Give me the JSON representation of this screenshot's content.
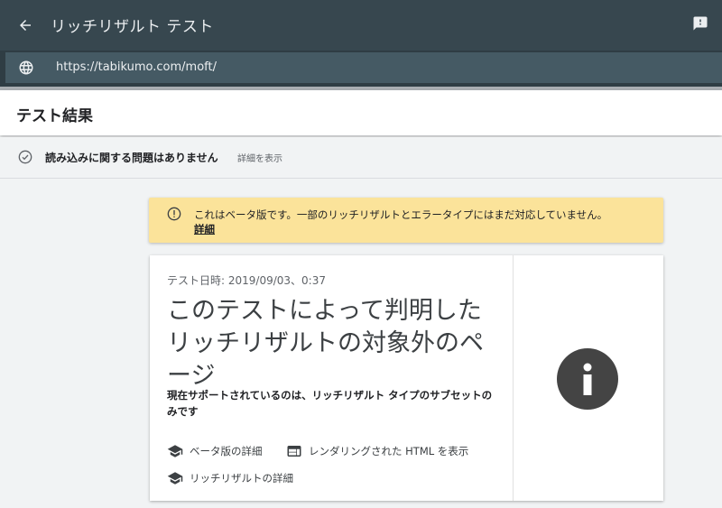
{
  "topbar": {
    "title": "リッチリザルト テスト",
    "back_icon": "arrow-back-icon",
    "feedback_icon": "feedback-icon"
  },
  "urlbar": {
    "url": "https://tabikumo.com/moft/",
    "icon": "globe-icon"
  },
  "header": {
    "title": "テスト結果"
  },
  "status": {
    "text": "読み込みに関する問題はありません",
    "detail_link": "詳細を表示"
  },
  "beta_notice": {
    "message": "これはベータ版です。一部のリッチリザルトとエラータイプにはまだ対応していません。",
    "link": "詳細"
  },
  "result_card": {
    "date": "テスト日時: 2019/09/03、0:37",
    "title": "このテストによって判明したリッチリザルトの対象外のページ",
    "subtitle": "現在サポートされているのは、リッチリザルト タイプのサブセットのみです",
    "links": {
      "beta_detail": "ベータ版の詳細",
      "rendered_html": "レンダリングされた HTML を表示",
      "rich_result_detail": "リッチリザルトの詳細"
    }
  },
  "colors": {
    "topbar": "#37474f",
    "urlfield": "#455a64",
    "notice": "#fbe39a",
    "info_icon": "#444444"
  }
}
